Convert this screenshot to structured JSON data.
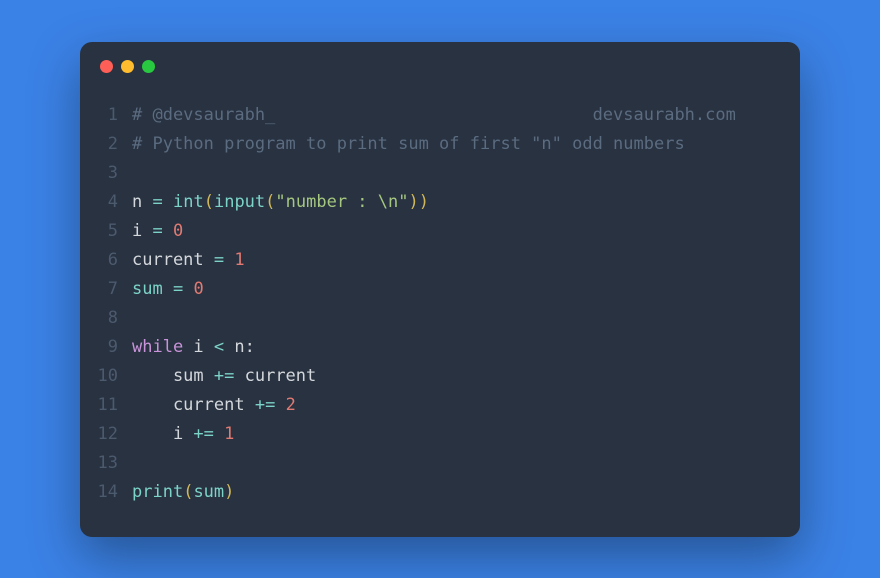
{
  "window": {
    "buttons": [
      "close",
      "minimize",
      "maximize"
    ]
  },
  "code": {
    "lines": [
      {
        "n": "1",
        "tokens": [
          {
            "cls": "comment",
            "text": "# @devsaurabh_                               devsaurabh.com"
          }
        ]
      },
      {
        "n": "2",
        "tokens": [
          {
            "cls": "comment",
            "text": "# Python program to print sum of first \"n\" odd numbers"
          }
        ]
      },
      {
        "n": "3",
        "tokens": []
      },
      {
        "n": "4",
        "tokens": [
          {
            "cls": "variable",
            "text": "n"
          },
          {
            "cls": "plain",
            "text": " "
          },
          {
            "cls": "operator",
            "text": "="
          },
          {
            "cls": "plain",
            "text": " "
          },
          {
            "cls": "keyword-func",
            "text": "int"
          },
          {
            "cls": "paren",
            "text": "("
          },
          {
            "cls": "keyword-func",
            "text": "input"
          },
          {
            "cls": "paren",
            "text": "("
          },
          {
            "cls": "string",
            "text": "\"number : \\n\""
          },
          {
            "cls": "paren",
            "text": ")"
          },
          {
            "cls": "paren",
            "text": ")"
          }
        ]
      },
      {
        "n": "5",
        "tokens": [
          {
            "cls": "variable",
            "text": "i"
          },
          {
            "cls": "plain",
            "text": " "
          },
          {
            "cls": "operator",
            "text": "="
          },
          {
            "cls": "plain",
            "text": " "
          },
          {
            "cls": "number",
            "text": "0"
          }
        ]
      },
      {
        "n": "6",
        "tokens": [
          {
            "cls": "variable",
            "text": "current"
          },
          {
            "cls": "plain",
            "text": " "
          },
          {
            "cls": "operator",
            "text": "="
          },
          {
            "cls": "plain",
            "text": " "
          },
          {
            "cls": "number",
            "text": "1"
          }
        ]
      },
      {
        "n": "7",
        "tokens": [
          {
            "cls": "keyword-func",
            "text": "sum"
          },
          {
            "cls": "plain",
            "text": " "
          },
          {
            "cls": "operator",
            "text": "="
          },
          {
            "cls": "plain",
            "text": " "
          },
          {
            "cls": "number",
            "text": "0"
          }
        ]
      },
      {
        "n": "8",
        "tokens": []
      },
      {
        "n": "9",
        "tokens": [
          {
            "cls": "keyword",
            "text": "while"
          },
          {
            "cls": "plain",
            "text": " i "
          },
          {
            "cls": "operator",
            "text": "<"
          },
          {
            "cls": "plain",
            "text": " n:"
          }
        ]
      },
      {
        "n": "10",
        "tokens": [
          {
            "cls": "plain",
            "text": "    sum "
          },
          {
            "cls": "operator",
            "text": "+="
          },
          {
            "cls": "plain",
            "text": " current"
          }
        ]
      },
      {
        "n": "11",
        "tokens": [
          {
            "cls": "plain",
            "text": "    current "
          },
          {
            "cls": "operator",
            "text": "+="
          },
          {
            "cls": "plain",
            "text": " "
          },
          {
            "cls": "number",
            "text": "2"
          }
        ]
      },
      {
        "n": "12",
        "tokens": [
          {
            "cls": "plain",
            "text": "    i "
          },
          {
            "cls": "operator",
            "text": "+="
          },
          {
            "cls": "plain",
            "text": " "
          },
          {
            "cls": "number",
            "text": "1"
          }
        ]
      },
      {
        "n": "13",
        "tokens": []
      },
      {
        "n": "14",
        "tokens": [
          {
            "cls": "keyword-func",
            "text": "print"
          },
          {
            "cls": "paren",
            "text": "("
          },
          {
            "cls": "keyword-func",
            "text": "sum"
          },
          {
            "cls": "paren",
            "text": ")"
          }
        ]
      }
    ]
  }
}
